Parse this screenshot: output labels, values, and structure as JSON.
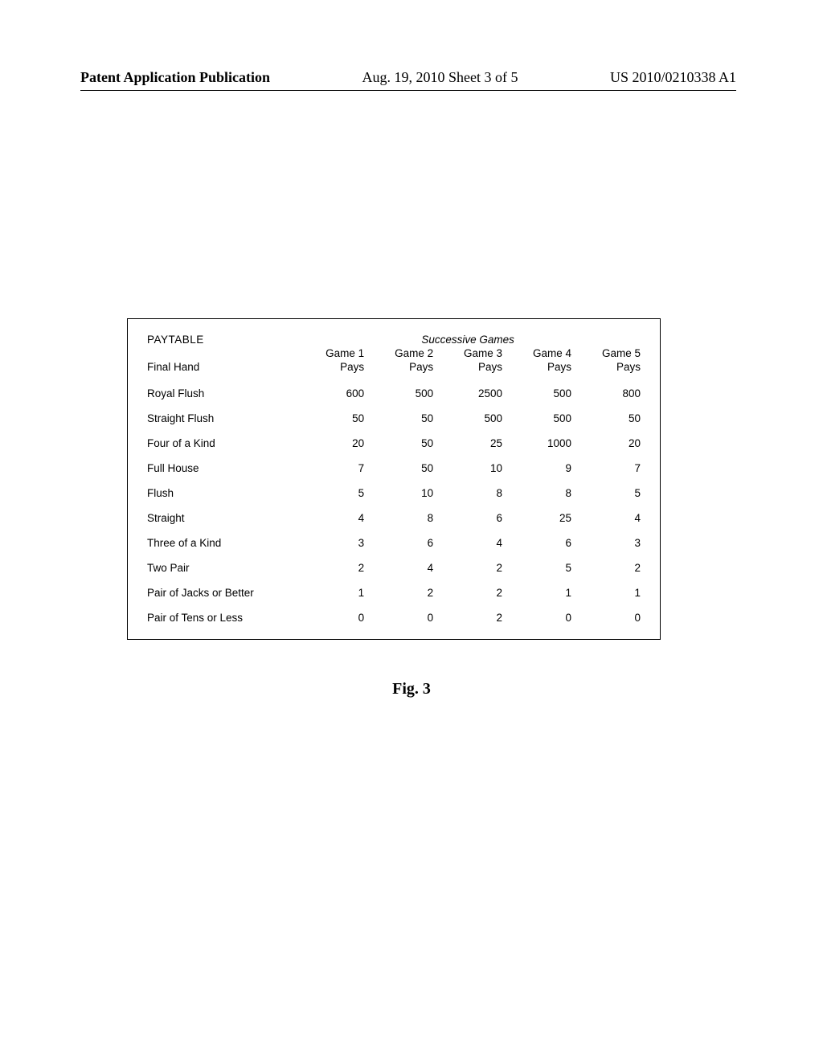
{
  "header": {
    "left": "Patent Application Publication",
    "center": "Aug. 19, 2010  Sheet 3 of 5",
    "right": "US 2010/0210338 A1"
  },
  "paytable": {
    "title": "PAYTABLE",
    "subhead": "Successive Games",
    "col_label_final_hand": "Final Hand",
    "columns": [
      {
        "line1": "Game 1",
        "line2": "Pays"
      },
      {
        "line1": "Game 2",
        "line2": "Pays"
      },
      {
        "line1": "Game 3",
        "line2": "Pays"
      },
      {
        "line1": "Game 4",
        "line2": "Pays"
      },
      {
        "line1": "Game 5",
        "line2": "Pays"
      }
    ],
    "rows": [
      {
        "hand": "Royal Flush",
        "v": [
          600,
          500,
          2500,
          500,
          800
        ]
      },
      {
        "hand": "Straight Flush",
        "v": [
          50,
          50,
          500,
          500,
          50
        ]
      },
      {
        "hand": "Four of a Kind",
        "v": [
          20,
          50,
          25,
          1000,
          20
        ]
      },
      {
        "hand": "Full House",
        "v": [
          7,
          50,
          10,
          9,
          7
        ]
      },
      {
        "hand": "Flush",
        "v": [
          5,
          10,
          8,
          8,
          5
        ]
      },
      {
        "hand": "Straight",
        "v": [
          4,
          8,
          6,
          25,
          4
        ]
      },
      {
        "hand": "Three of a Kind",
        "v": [
          3,
          6,
          4,
          6,
          3
        ]
      },
      {
        "hand": "Two Pair",
        "v": [
          2,
          4,
          2,
          5,
          2
        ]
      },
      {
        "hand": "Pair of Jacks or Better",
        "v": [
          1,
          2,
          2,
          1,
          1
        ]
      },
      {
        "hand": "Pair of Tens or Less",
        "v": [
          0,
          0,
          2,
          0,
          0
        ]
      }
    ]
  },
  "figure_label": "Fig. 3",
  "chart_data": {
    "type": "table",
    "title": "PAYTABLE — Successive Games",
    "row_labels": [
      "Royal Flush",
      "Straight Flush",
      "Four of a Kind",
      "Full House",
      "Flush",
      "Straight",
      "Three of a Kind",
      "Two Pair",
      "Pair of Jacks or Better",
      "Pair of Tens or Less"
    ],
    "column_labels": [
      "Game 1 Pays",
      "Game 2 Pays",
      "Game 3 Pays",
      "Game 4 Pays",
      "Game 5 Pays"
    ],
    "values": [
      [
        600,
        500,
        2500,
        500,
        800
      ],
      [
        50,
        50,
        500,
        500,
        50
      ],
      [
        20,
        50,
        25,
        1000,
        20
      ],
      [
        7,
        50,
        10,
        9,
        7
      ],
      [
        5,
        10,
        8,
        8,
        5
      ],
      [
        4,
        8,
        6,
        25,
        4
      ],
      [
        3,
        6,
        4,
        6,
        3
      ],
      [
        2,
        4,
        2,
        5,
        2
      ],
      [
        1,
        2,
        2,
        1,
        1
      ],
      [
        0,
        0,
        2,
        0,
        0
      ]
    ]
  }
}
